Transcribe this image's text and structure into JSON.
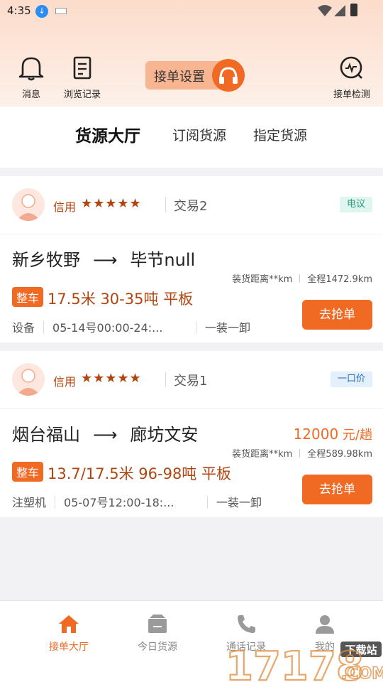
{
  "status_bar": {
    "time": "4:35"
  },
  "header": {
    "messages_label": "消息",
    "history_label": "浏览记录",
    "order_settings_label": "接单设置",
    "order_check_label": "接单检测"
  },
  "tabs": [
    {
      "label": "货源大厅",
      "active": true
    },
    {
      "label": "订阅货源",
      "active": false
    },
    {
      "label": "指定货源",
      "active": false
    }
  ],
  "listings": [
    {
      "credit_label": "信用",
      "stars": "★★★★★",
      "trades": "交易2",
      "tag": "电议",
      "from": "新乡牧野",
      "arrow": "⟶",
      "to": "毕节null",
      "price_amount": "",
      "price_unit": "",
      "load_distance": "装货距离**km",
      "total_distance": "全程1472.9km",
      "load_type": "整车",
      "spec": "17.5米 30-35吨 平板",
      "goods": "设备",
      "date": "05-14号00:00-24:...",
      "handling": "一装一卸",
      "action": "去抢单"
    },
    {
      "credit_label": "信用",
      "stars": "★★★★★",
      "trades": "交易1",
      "tag": "一口价",
      "from": "烟台福山",
      "arrow": "⟶",
      "to": "廊坊文安",
      "price_amount": "12000",
      "price_unit": " 元/趟",
      "load_distance": "装货距离**km",
      "total_distance": "全程589.98km",
      "load_type": "整车",
      "spec": "13.7/17.5米 96-98吨 平板",
      "goods": "注塑机",
      "date": "05-07号12:00-18:...",
      "handling": "一装一卸",
      "action": "去抢单"
    }
  ],
  "bottom_nav": [
    {
      "label": "接单大厅",
      "icon": "home-icon",
      "active": true
    },
    {
      "label": "今日货源",
      "icon": "box-icon",
      "active": false
    },
    {
      "label": "通话记录",
      "icon": "phone-icon",
      "active": false
    },
    {
      "label": "我的",
      "icon": "user-icon",
      "active": false
    }
  ],
  "watermark": {
    "text": "17178",
    "sub": "下载站",
    "suffix": ".COM"
  },
  "colors": {
    "accent": "#f06a24",
    "credit": "#b1450f"
  }
}
